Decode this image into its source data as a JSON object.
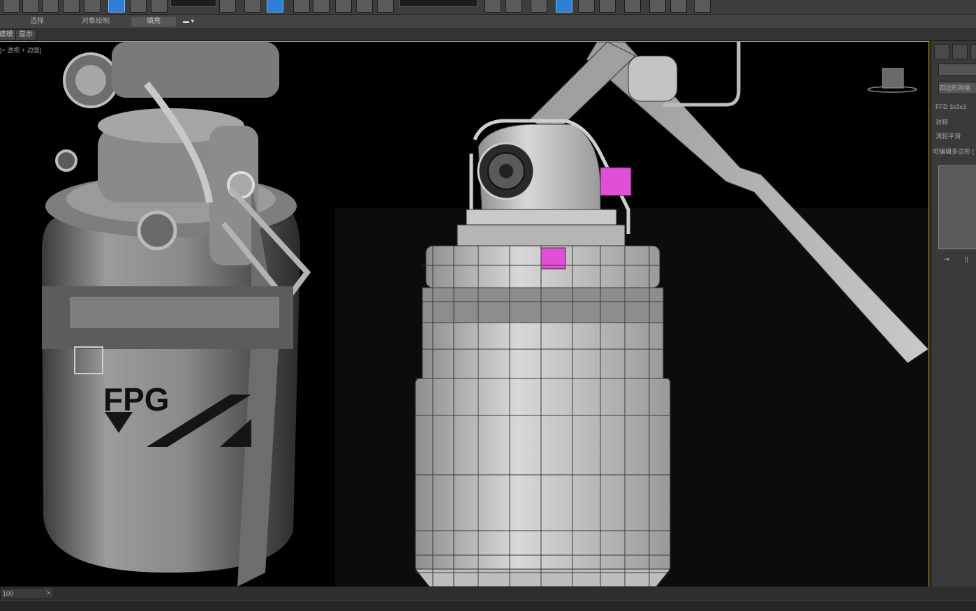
{
  "tabs": [
    {
      "label": "选择"
    },
    {
      "label": "对象绘制"
    },
    {
      "label": "填充"
    }
  ],
  "subtoolbar": {
    "btn1": "建模",
    "btn2": "显示"
  },
  "viewport": {
    "label": "[+ 透视 + 边面]",
    "model_text": "FPG"
  },
  "right_panel": {
    "row1": "四边形网格",
    "row2": "FFD 3x3x3",
    "row3": "对称",
    "row4": "涡轮平滑",
    "row5": "可编辑多边形 (W",
    "bottom_left": "⇥",
    "bottom_right": "||"
  },
  "timeline": {
    "frame": "100",
    "next": ">"
  },
  "colors": {
    "accent": "#c7a43b",
    "selection": "#e04fd6",
    "active_button": "#2f7fd6"
  }
}
